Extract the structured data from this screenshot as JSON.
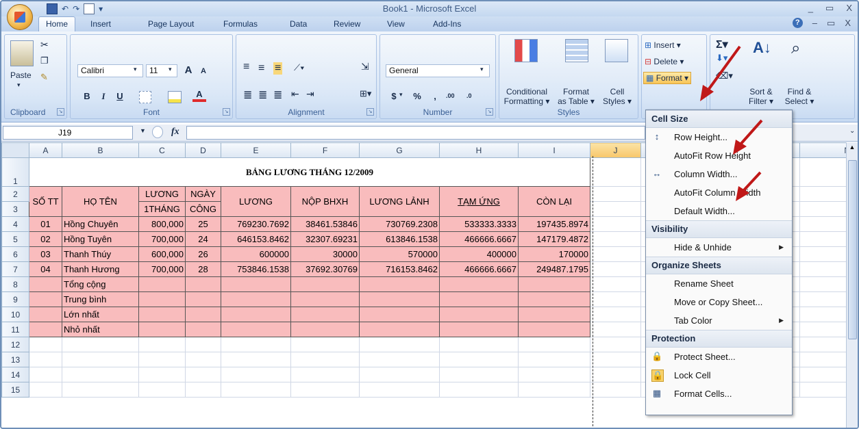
{
  "window": {
    "title": "Book1 - Microsoft Excel",
    "min": "_",
    "restore": "▭",
    "close": "X"
  },
  "office_button": {
    "label": "Office"
  },
  "qat": {
    "save": "▪",
    "undo": "↶",
    "redo": "↷",
    "print": "▫",
    "more": "▾"
  },
  "tabs": [
    "Home",
    "Insert",
    "Page Layout",
    "Formulas",
    "Data",
    "Review",
    "View",
    "Add-Ins"
  ],
  "help": {
    "q": "?",
    "min": "–",
    "restore": "▭",
    "close": "X"
  },
  "ribbon": {
    "clipboard": {
      "label": "Clipboard",
      "paste": "Paste",
      "launcher": "↘"
    },
    "font": {
      "label": "Font",
      "name": "Calibri",
      "size": "11",
      "grow": "A",
      "shrink": "A",
      "bold": "B",
      "italic": "I",
      "underline": "U",
      "launcher": "↘"
    },
    "alignment": {
      "label": "Alignment",
      "launcher": "↘"
    },
    "number": {
      "label": "Number",
      "format": "General",
      "currency": "$",
      "percent": "%",
      "comma": ",",
      "inc": ".00",
      "dec": ".0",
      "launcher": "↘"
    },
    "styles": {
      "label": "Styles",
      "cond": [
        "Conditional",
        "Formatting ▾"
      ],
      "table": [
        "Format",
        "as Table ▾"
      ],
      "cell": [
        "Cell",
        "Styles ▾"
      ]
    },
    "cells": {
      "insert": "Insert ▾",
      "delete": "Delete ▾",
      "format": "Format ▾"
    },
    "editing": {
      "sort": [
        "Sort &",
        "Filter ▾"
      ],
      "find": [
        "Find &",
        "Select ▾"
      ]
    }
  },
  "formula_bar": {
    "name_box": "J19",
    "fx": "fx"
  },
  "sheet": {
    "columns": [
      "A",
      "B",
      "C",
      "D",
      "E",
      "F",
      "G",
      "H",
      "I",
      "J",
      "",
      "",
      "",
      "N"
    ],
    "title": "BẢNG LƯƠNG THÁNG 12/2009",
    "headers": {
      "stt": "SỐ TT",
      "hoten": "HỌ TÊN",
      "luong1": "LƯƠNG",
      "luong1b": "1THÁNG",
      "ngay": "NGÀY",
      "ngayb": "CÔNG",
      "luong": "LƯƠNG",
      "bhxh": "NỘP BHXH",
      "linh": "LƯƠNG LẢNH",
      "tamung": "TẠM ỨNG",
      "conlai": "CÒN LẠI"
    },
    "rows": [
      {
        "stt": "01",
        "name": "Hồng Chuyên",
        "l1": "800,000",
        "nc": "25",
        "luong": "769230.7692",
        "bhxh": "38461.53846",
        "linh": "730769.2308",
        "tu": "533333.3333",
        "cl": "197435.8974"
      },
      {
        "stt": "02",
        "name": "Hồng Tuyên",
        "l1": "700,000",
        "nc": "24",
        "luong": "646153.8462",
        "bhxh": "32307.69231",
        "linh": "613846.1538",
        "tu": "466666.6667",
        "cl": "147179.4872"
      },
      {
        "stt": "03",
        "name": "Thanh Thúy",
        "l1": "600,000",
        "nc": "26",
        "luong": "600000",
        "bhxh": "30000",
        "linh": "570000",
        "tu": "400000",
        "cl": "170000"
      },
      {
        "stt": "04",
        "name": "Thanh Hương",
        "l1": "700,000",
        "nc": "28",
        "luong": "753846.1538",
        "bhxh": "37692.30769",
        "linh": "716153.8462",
        "tu": "466666.6667",
        "cl": "249487.1795"
      }
    ],
    "summary": [
      "Tổng cộng",
      "Trung bình",
      "Lớn nhất",
      "Nhỏ nhất"
    ]
  },
  "menu": {
    "cell_size": "Cell Size",
    "row_height": "Row Height...",
    "autofit_row": "AutoFit Row Height",
    "col_width": "Column Width...",
    "autofit_col": "AutoFit Column Width",
    "default_width": "Default Width...",
    "visibility": "Visibility",
    "hide_unhide": "Hide & Unhide",
    "organize": "Organize Sheets",
    "rename": "Rename Sheet",
    "move_copy": "Move or Copy Sheet...",
    "tab_color": "Tab Color",
    "protection": "Protection",
    "protect": "Protect Sheet...",
    "lock": "Lock Cell",
    "format_cells": "Format Cells..."
  }
}
